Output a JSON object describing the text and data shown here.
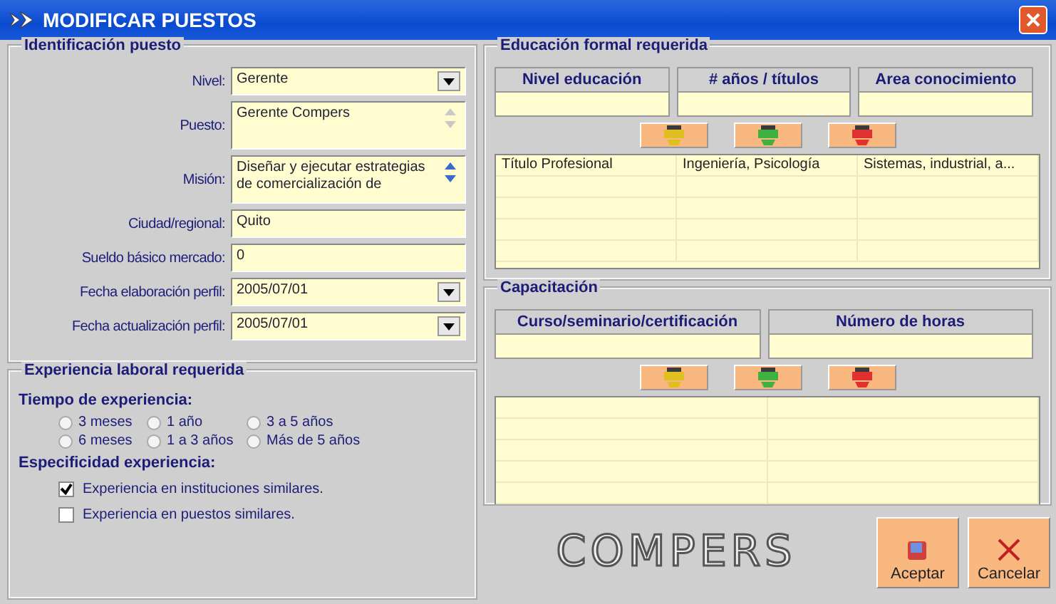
{
  "window": {
    "title": "MODIFICAR PUESTOS"
  },
  "identificacion": {
    "title": "Identificación puesto",
    "fields": [
      {
        "kind": "select",
        "label": "Nivel:",
        "value": "Gerente"
      },
      {
        "kind": "memo",
        "label": "Puesto:",
        "value": "Gerente Compers",
        "scroll_enabled": false
      },
      {
        "kind": "memo",
        "label": "Misión:",
        "value": "Diseñar y ejecutar estrategias de comercialización de",
        "scroll_enabled": true
      },
      {
        "kind": "text",
        "label": "Ciudad/regional:",
        "value": "Quito"
      },
      {
        "kind": "text",
        "label": "Sueldo básico mercado:",
        "value": "0"
      },
      {
        "kind": "select",
        "label": "Fecha elaboración perfil:",
        "value": "2005/07/01"
      },
      {
        "kind": "select",
        "label": "Fecha actualización perfil:",
        "value": "2005/07/01"
      }
    ]
  },
  "experiencia": {
    "title": "Experiencia laboral requerida",
    "tiempo_label": "Tiempo de experiencia:",
    "options": [
      {
        "label": "3 meses",
        "selected": false
      },
      {
        "label": "1 año",
        "selected": false
      },
      {
        "label": "3 a 5 años",
        "selected": false
      },
      {
        "label": "6 meses",
        "selected": false
      },
      {
        "label": "1 a 3 años",
        "selected": false
      },
      {
        "label": "Más de 5 años",
        "selected": false
      }
    ],
    "especificidad_label": "Especificidad experiencia:",
    "checks": [
      {
        "label": "Experiencia en instituciones  similares.",
        "checked": true
      },
      {
        "label": "Experiencia en puestos  similares.",
        "checked": false
      }
    ]
  },
  "educacion": {
    "title": "Educación formal requerida",
    "columns": [
      "Nivel educación",
      "# años / títulos",
      "Area conocimiento"
    ],
    "rows": [
      [
        "Título Profesional",
        "Ingeniería, Psicología",
        "Sistemas, industrial, a..."
      ]
    ]
  },
  "capacitacion": {
    "title": "Capacitación",
    "columns": [
      "Curso/seminario/certificación",
      "Número de horas"
    ]
  },
  "logo": "COMPERS",
  "buttons": [
    {
      "kind": "accept",
      "label": "Aceptar"
    },
    {
      "kind": "cancel",
      "label": "Cancelar"
    }
  ]
}
